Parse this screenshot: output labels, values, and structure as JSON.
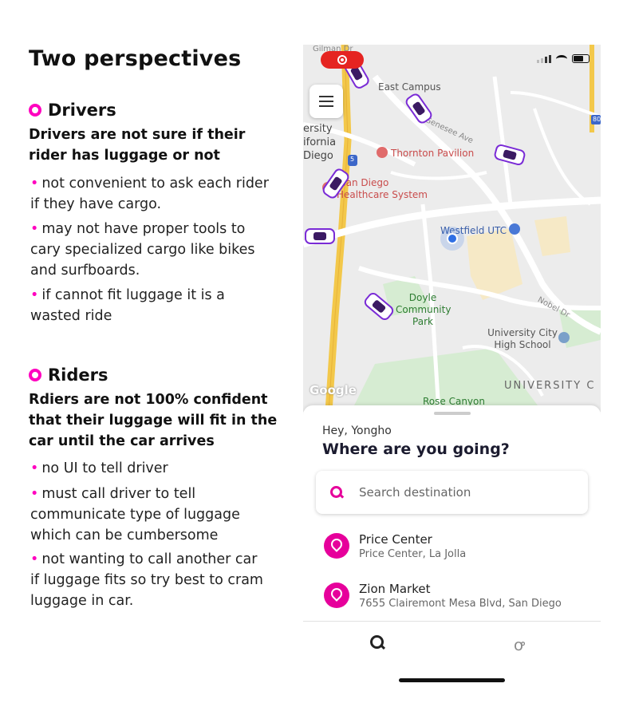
{
  "slide": {
    "title": "Two  perspectives",
    "drivers": {
      "heading": "Drivers",
      "summary": "Drivers are not sure if their rider has luggage or not",
      "bullets": [
        "not convenient to ask each rider if they have cargo.",
        "may not have proper tools to cary specialized cargo like bikes and surfboards.",
        "if cannot fit luggage it is a wasted ride"
      ]
    },
    "riders": {
      "heading": "Riders",
      "summary": "Rdiers are not 100% confident that their luggage will fit in the car until the car arrives",
      "bullets": [
        "no UI to tell driver",
        "must call driver to tell communicate type of luggage which can be cumbersome",
        "not wanting to call another car if luggage fits so try best to cram luggage in car."
      ]
    },
    "bullet_glyph": "•"
  },
  "app": {
    "map": {
      "labels": {
        "east_campus": "East Campus",
        "gilman": "Gilman Dr",
        "genesee": "Genesee Ave",
        "ucsd_1": "ersity",
        "ucsd_2": "ifornia",
        "ucsd_3": "Diego",
        "thornton": "Thornton Pavilion",
        "health_1": "San Diego",
        "health_2": "Healthcare System",
        "westfield": "Westfield UTC",
        "doyle": "Doyle Community Park",
        "nobel": "Nobel Dr",
        "uc_high": "University City High School",
        "university": "UNIVERSITY C",
        "rose": "Rose Canyon",
        "interstate": "5",
        "route": "80"
      },
      "google_mark": "Google"
    },
    "icons": {
      "menu": "hamburger-menu-icon",
      "record": "screen-record-icon",
      "search": "search-icon",
      "place": "location-pin-icon",
      "scooter": "scooter-icon"
    },
    "colors": {
      "accent": "#e6009b",
      "car": "#7a2bd6",
      "record": "#e52421",
      "user_location": "#2f6fe4"
    },
    "sheet": {
      "greeting": "Hey, Yongho",
      "question": "Where are you going?",
      "search_placeholder": "Search destination",
      "places": [
        {
          "name": "Price Center",
          "address": "Price Center, La Jolla"
        },
        {
          "name": "Zion Market",
          "address": "7655 Clairemont Mesa Blvd, San Diego"
        }
      ]
    },
    "tabs": {
      "scooter_glyph": "ꝍ"
    }
  }
}
